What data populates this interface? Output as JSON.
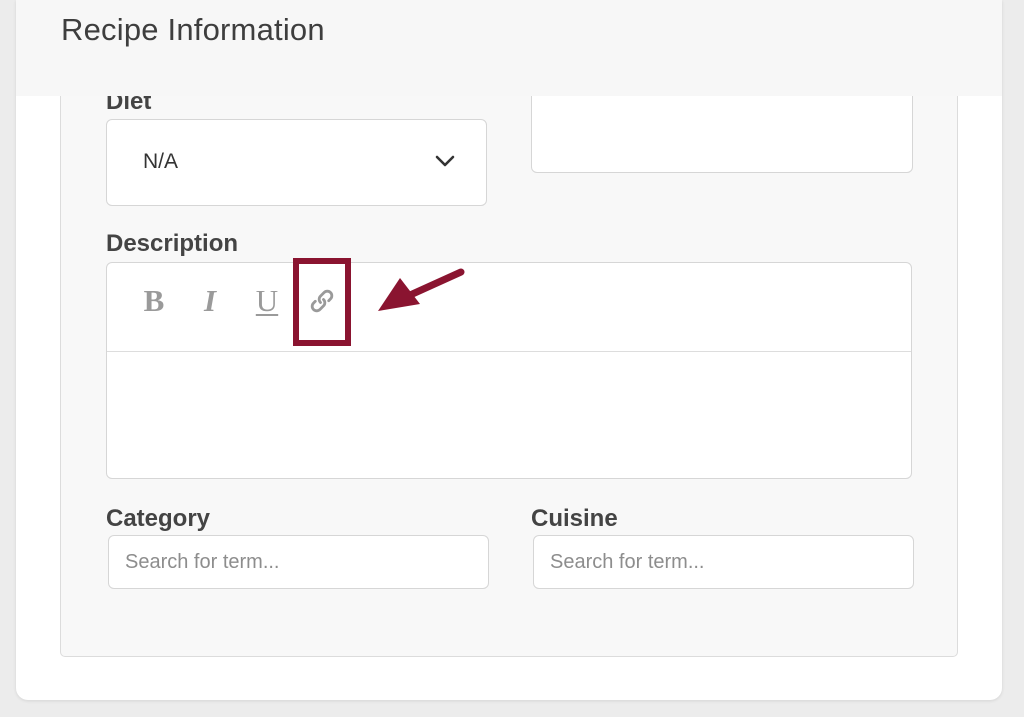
{
  "section": {
    "title": "Recipe Information"
  },
  "diet": {
    "label": "Diet",
    "selected": "N/A"
  },
  "description": {
    "label": "Description",
    "toolbar": {
      "bold": "B",
      "italic": "I",
      "underline": "U",
      "link_icon": "link-icon"
    },
    "body": ""
  },
  "category": {
    "label": "Category",
    "placeholder": "Search for term...",
    "value": ""
  },
  "cuisine": {
    "label": "Cuisine",
    "placeholder": "Search for term...",
    "value": ""
  },
  "annotation": {
    "color": "#8a1430"
  }
}
